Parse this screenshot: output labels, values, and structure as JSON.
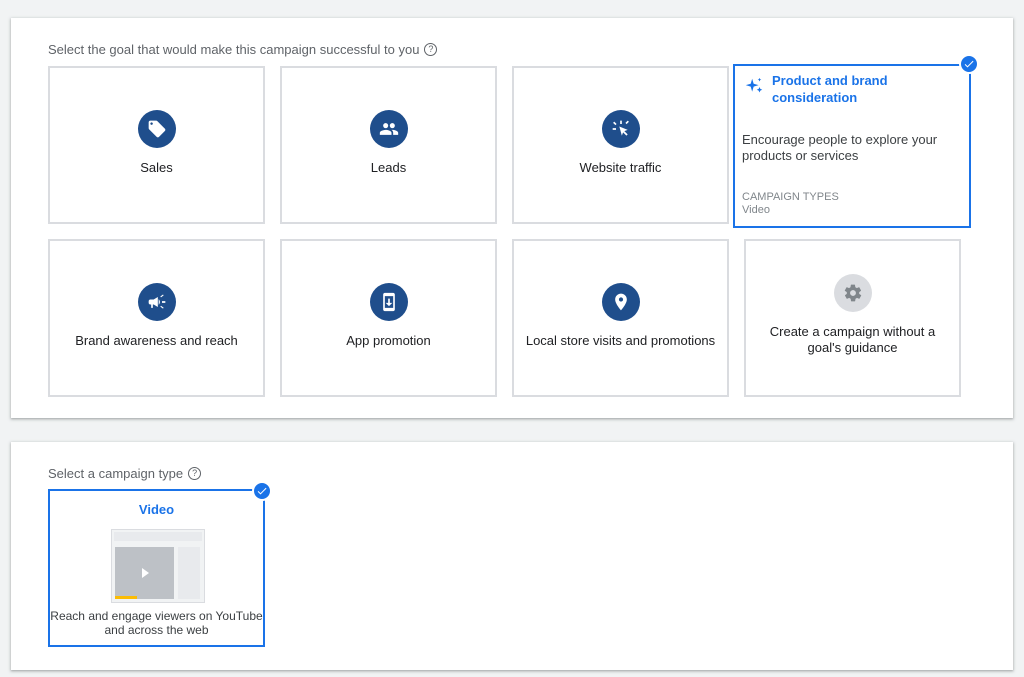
{
  "goal_section": {
    "title": "Select the goal that would make this campaign successful to you",
    "help_icon": "help-icon",
    "goals": [
      {
        "label": "Sales",
        "icon": "tag-icon"
      },
      {
        "label": "Leads",
        "icon": "people-icon"
      },
      {
        "label": "Website traffic",
        "icon": "cursor-click-icon"
      },
      {
        "label": "Product and brand consideration",
        "icon": "sparkle-icon",
        "selected": true,
        "description": "Encourage people to explore your products or services",
        "campaign_types_label": "CAMPAIGN TYPES",
        "campaign_types_value": "Video"
      },
      {
        "label": "Brand awareness and reach",
        "icon": "megaphone-icon"
      },
      {
        "label": "App promotion",
        "icon": "phone-download-icon"
      },
      {
        "label": "Local store visits and promotions",
        "icon": "location-pin-icon"
      },
      {
        "label": "Create a campaign without a goal's guidance",
        "icon": "gear-icon"
      }
    ]
  },
  "type_section": {
    "title": "Select a campaign type",
    "help_icon": "help-icon",
    "types": [
      {
        "label": "Video",
        "selected": true,
        "description": "Reach and engage viewers on YouTube and across the web"
      }
    ]
  },
  "colors": {
    "accent": "#1a73e8",
    "icon_bg": "#1f4e8c",
    "border": "#dadce0",
    "progress": "#fbbc04"
  }
}
